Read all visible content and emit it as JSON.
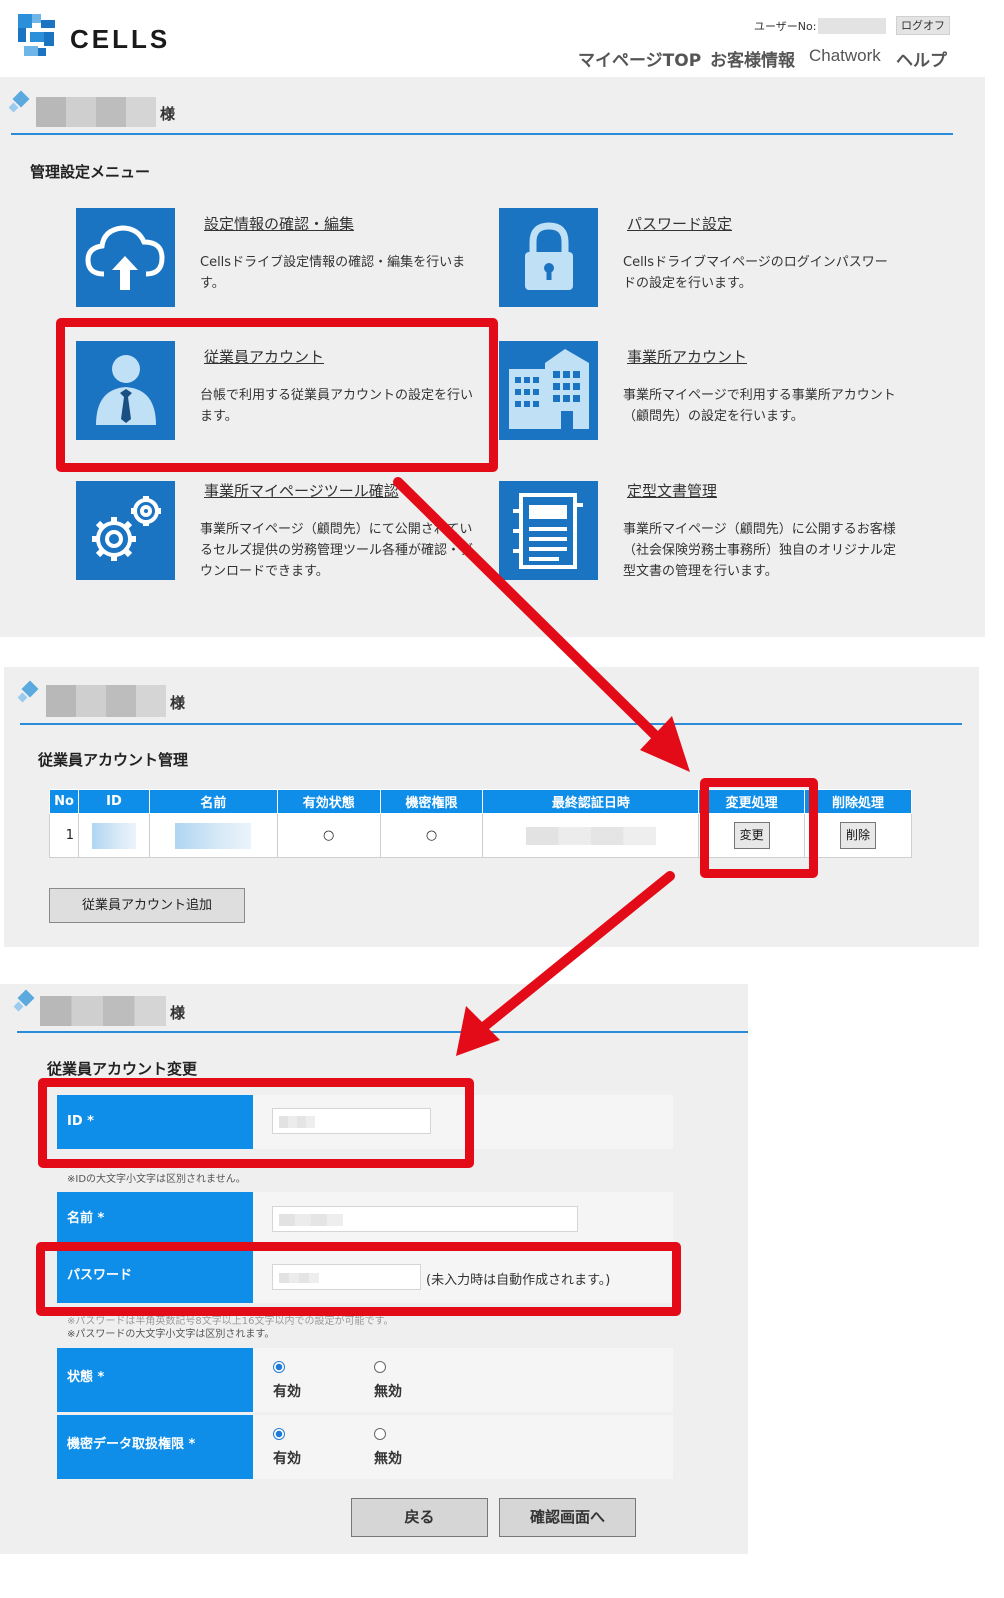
{
  "header": {
    "logo_text": "CELLS",
    "user_label": "ユーザーNo:",
    "logoff_label": "ログオフ",
    "nav": [
      {
        "label": "マイページTOP"
      },
      {
        "label": "お客様情報"
      },
      {
        "label": "Chatwork"
      },
      {
        "label": "ヘルプ"
      }
    ]
  },
  "greeting_suffix": "様",
  "menu_panel": {
    "section_title": "管理設定メニュー",
    "items": [
      {
        "title": "設定情報の確認・編集",
        "desc": "Cellsドライブ設定情報の確認・編集を行います。",
        "icon": "cloud-upload-icon"
      },
      {
        "title": "パスワード設定",
        "desc": "Cellsドライブマイページのログインパスワードの設定を行います。",
        "icon": "lock-icon"
      },
      {
        "title": "従業員アカウント",
        "desc": "台帳で利用する従業員アカウントの設定を行います。",
        "icon": "employee-icon"
      },
      {
        "title": "事業所アカウント",
        "desc": "事業所マイページで利用する事業所アカウント（顧問先）の設定を行います。",
        "icon": "building-icon"
      },
      {
        "title": "事業所マイページツール確認",
        "desc": "事業所マイページ（顧問先）にて公開されているセルズ提供の労務管理ツール各種が確認・ダウンロードできます。",
        "icon": "gears-icon"
      },
      {
        "title": "定型文書管理",
        "desc": "事業所マイページ（顧問先）に公開するお客様（社会保険労務士事務所）独自のオリジナル定型文書の管理を行います。",
        "icon": "document-icon"
      }
    ]
  },
  "account_panel": {
    "section_title": "従業員アカウント管理",
    "columns": [
      "No",
      "ID",
      "名前",
      "有効状態",
      "機密権限",
      "最終認証日時",
      "変更処理",
      "削除処理"
    ],
    "rows": [
      {
        "no": "1",
        "active": "○",
        "confidential": "○",
        "edit_label": "変更",
        "delete_label": "削除"
      }
    ],
    "add_button": "従業員アカウント追加"
  },
  "edit_panel": {
    "section_title": "従業員アカウント変更",
    "id_label": "ID *",
    "id_note": "※IDの大文字小文字は区別されません。",
    "name_label": "名前 *",
    "password_label": "パスワード",
    "password_hint": "(未入力時は自動作成されます。)",
    "password_note1": "※パスワードは半角英数記号8文字以上16文字以内での設定が可能です。",
    "password_note2": "※パスワードの大文字小文字は区別されます。",
    "status_label": "状態 *",
    "confidential_label": "機密データ取扱権限 *",
    "option_on": "有効",
    "option_off": "無効",
    "back_button": "戻る",
    "confirm_button": "確認画面へ"
  },
  "colors": {
    "accent_blue": "#0e8ee8",
    "tile_blue": "#1a74c2",
    "highlight_red": "#e30b17",
    "panel_gray": "#efefef"
  }
}
